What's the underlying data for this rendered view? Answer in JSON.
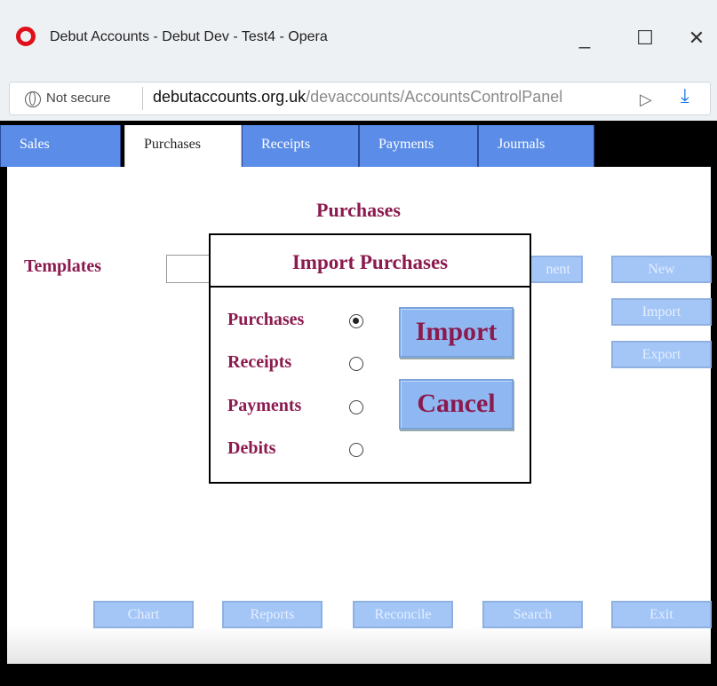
{
  "window": {
    "title": "Debut Accounts - Debut Dev - Test4 - Opera",
    "minimize_glyph": "_",
    "maximize_glyph": "☐",
    "close_glyph": "✕"
  },
  "address_bar": {
    "security_label": "Not secure",
    "url_host": "debutaccounts.org.uk",
    "url_path": "/devaccounts/AccountsControlPanel",
    "send_glyph": "▷",
    "download_glyph": "⤓"
  },
  "tabs": [
    {
      "label": "Sales",
      "active": false
    },
    {
      "label": "Purchases",
      "active": true
    },
    {
      "label": "Receipts",
      "active": false
    },
    {
      "label": "Payments",
      "active": false
    },
    {
      "label": "Journals",
      "active": false
    }
  ],
  "page": {
    "title": "Purchases",
    "templates_label": "Templates",
    "templates_value": ""
  },
  "side_buttons": {
    "hidden_partial": "nent",
    "new": "New",
    "import": "Import",
    "export": "Export"
  },
  "bottom_buttons": {
    "chart": "Chart",
    "reports": "Reports",
    "reconcile": "Reconcile",
    "search": "Search",
    "exit": "Exit"
  },
  "dialog": {
    "title": "Import Purchases",
    "options": [
      {
        "label": "Purchases",
        "selected": true
      },
      {
        "label": "Receipts",
        "selected": false
      },
      {
        "label": "Payments",
        "selected": false
      },
      {
        "label": "Debits",
        "selected": false
      }
    ],
    "import_label": "Import",
    "cancel_label": "Cancel"
  },
  "colors": {
    "accent_text": "#8b1a4e",
    "tab_blue": "#5b8de8",
    "button_blue": "#8fb8f2",
    "disabled_button": "#a3c6f7"
  }
}
